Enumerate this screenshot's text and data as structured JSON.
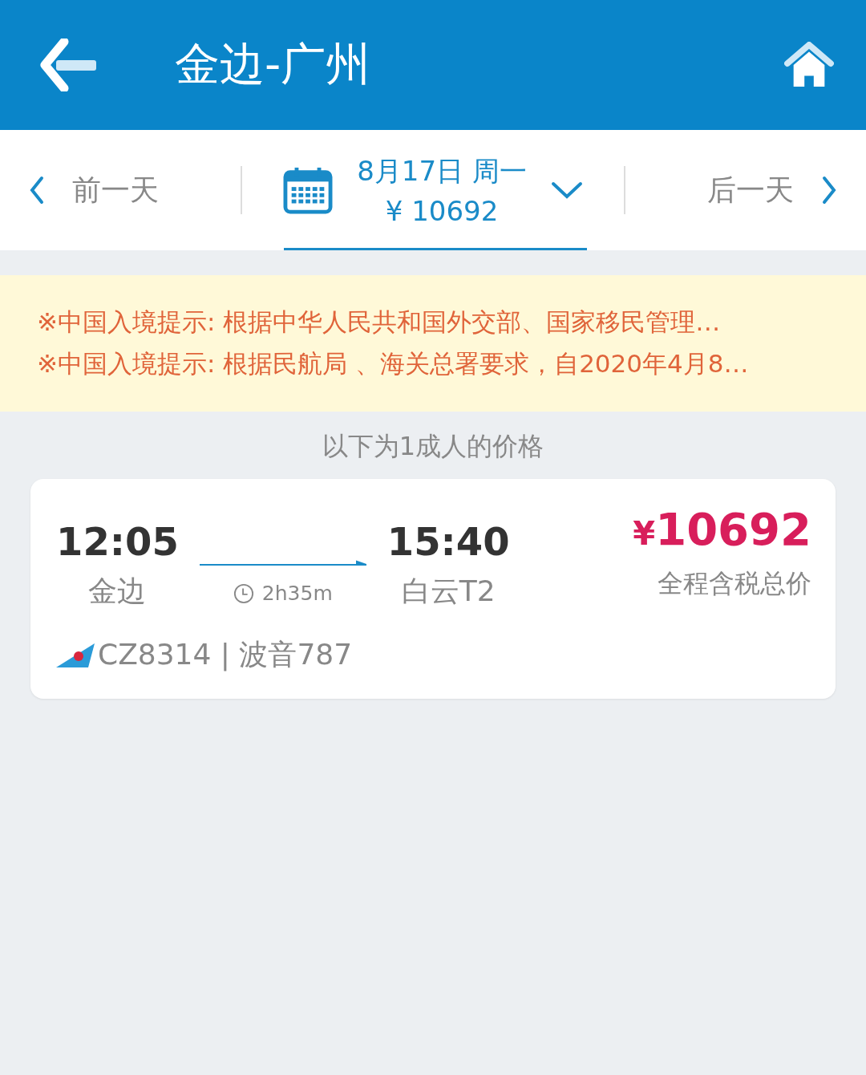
{
  "header": {
    "title": "金边-广州"
  },
  "date_bar": {
    "prev_label": "前一天",
    "date": "8月17日 周一",
    "price": "¥ 10692",
    "next_label": "后一天"
  },
  "notices": [
    "※中国入境提示: 根据中华人民共和国外交部、国家移民管理…",
    "※中国入境提示: 根据民航局 、海关总署要求，自2020年4月8…"
  ],
  "caption": "以下为1成人的价格",
  "flights": [
    {
      "depart_time": "12:05",
      "depart_airport": "金边",
      "duration": "2h35m",
      "arrive_time": "15:40",
      "arrive_airport": "白云T2",
      "currency": "¥",
      "price": "10692",
      "price_note": "全程含税总价",
      "flight_info": "CZ8314 | 波音787"
    }
  ]
}
